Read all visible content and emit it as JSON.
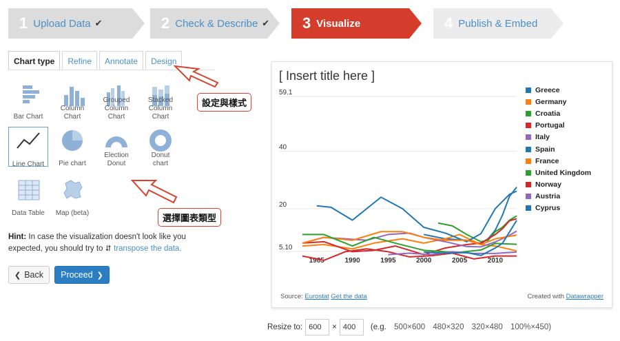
{
  "steps": [
    {
      "num": "1",
      "label": "Upload Data",
      "check": "✔"
    },
    {
      "num": "2",
      "label": "Check & Describe",
      "check": "✔"
    },
    {
      "num": "3",
      "label": "Visualize",
      "check": ""
    },
    {
      "num": "4",
      "label": "Publish & Embed",
      "check": ""
    }
  ],
  "tabs": [
    "Chart type",
    "Refine",
    "Annotate",
    "Design"
  ],
  "chart_types": [
    {
      "label1": "Bar Chart",
      "label2": ""
    },
    {
      "label1": "Column",
      "label2": "Chart"
    },
    {
      "label1": "Grouped",
      "label2": "Column Chart"
    },
    {
      "label1": "Stacked",
      "label2": "Column Chart"
    },
    {
      "label1": "Line Chart",
      "label2": ""
    },
    {
      "label1": "Pie chart",
      "label2": ""
    },
    {
      "label1": "Election",
      "label2": "Donut"
    },
    {
      "label1": "Donut",
      "label2": "chart"
    },
    {
      "label1": "Data Table",
      "label2": ""
    },
    {
      "label1": "Map (beta)",
      "label2": ""
    }
  ],
  "annotations": {
    "settings_style": "設定與樣式",
    "choose_chart_type": "選擇圖表類型"
  },
  "hint": {
    "bold": "Hint:",
    "text": "In case the visualization doesn't look like you expected, you should try to",
    "link": "transpose the data."
  },
  "buttons": {
    "back": "Back",
    "proceed": "Proceed"
  },
  "chart": {
    "title": "[ Insert title here ]",
    "source_label": "Source:",
    "source_link": "Eurostat",
    "get_data": "Get the data",
    "created_with": "Created with",
    "datawrapper": "Datawrapper"
  },
  "resize": {
    "label": "Resize to:",
    "width": "600",
    "times": "×",
    "height": "400",
    "eg": "(e.g.",
    "presets": [
      "500×600",
      "480×320",
      "320×480",
      "100%×450)"
    ]
  },
  "colors": {
    "accent_red": "#d43d2b",
    "link_blue": "#4a90c8"
  },
  "chart_data": {
    "type": "line",
    "title": "[ Insert title here ]",
    "y_ticks": [
      "59.1",
      "40",
      "20",
      "5.10"
    ],
    "x_ticks": [
      "1985",
      "1990",
      "1995",
      "2000",
      "2005",
      "2010"
    ],
    "xlim": [
      1983,
      2013
    ],
    "ylim": [
      5.1,
      59.1
    ],
    "series": [
      {
        "name": "Greece",
        "color": "#1f77b4",
        "x": [
          2000,
          2003,
          2006,
          2008,
          2009,
          2010,
          2011,
          2012,
          2013
        ],
        "y": [
          11,
          9.5,
          9,
          7.8,
          9.5,
          12.5,
          17.7,
          24.3,
          27.5
        ]
      },
      {
        "name": "Germany",
        "color": "#ff7f0e",
        "x": [
          1983,
          1986,
          1990,
          1993,
          1997,
          2000,
          2003,
          2005,
          2008,
          2010,
          2013
        ],
        "y": [
          7,
          7.5,
          6,
          8,
          9.5,
          8,
          9.5,
          11,
          7.5,
          7,
          5.3
        ]
      },
      {
        "name": "Croatia",
        "color": "#2ca02c",
        "x": [
          2002,
          2004,
          2006,
          2008,
          2009,
          2010,
          2011,
          2012,
          2013
        ],
        "y": [
          15,
          14,
          11,
          8.5,
          9,
          12,
          13.5,
          16,
          17.5
        ]
      },
      {
        "name": "Portugal",
        "color": "#d62728",
        "x": [
          1983,
          1986,
          1990,
          1993,
          1996,
          2000,
          2003,
          2006,
          2008,
          2010,
          2011,
          2012,
          2013
        ],
        "y": [
          8,
          8.5,
          5,
          5.5,
          7,
          4,
          6.3,
          7.5,
          8,
          11,
          13,
          15.8,
          16.5
        ]
      },
      {
        "name": "Italy",
        "color": "#9467bd",
        "x": [
          1983,
          1986,
          1989,
          1992,
          1995,
          1998,
          2000,
          2003,
          2006,
          2008,
          2010,
          2012,
          2013
        ],
        "y": [
          8,
          10,
          9.5,
          9,
          11,
          11.5,
          10,
          8.5,
          6.8,
          6.7,
          8.4,
          10.7,
          12.2
        ]
      },
      {
        "name": "Spain",
        "color": "#1f77b4",
        "x": [
          1985,
          1987,
          1990,
          1994,
          1997,
          2000,
          2003,
          2006,
          2008,
          2010,
          2012,
          2013
        ],
        "y": [
          21,
          20.5,
          16,
          24,
          20,
          13.5,
          11.5,
          8.5,
          11.3,
          20,
          25,
          26.1
        ]
      },
      {
        "name": "France",
        "color": "#ff7f0e",
        "x": [
          1983,
          1986,
          1990,
          1994,
          1997,
          2000,
          2003,
          2006,
          2008,
          2010,
          2013
        ],
        "y": [
          8,
          10,
          9,
          12,
          12,
          10,
          9,
          9,
          7.5,
          9.5,
          10.8
        ]
      },
      {
        "name": "United Kingdom",
        "color": "#2ca02c",
        "x": [
          1983,
          1986,
          1990,
          1993,
          1996,
          2000,
          2003,
          2005,
          2008,
          2010,
          2013
        ],
        "y": [
          11,
          11,
          7,
          10,
          8,
          5.5,
          5,
          4.8,
          5.6,
          7.9,
          7.6
        ]
      },
      {
        "name": "Norway",
        "color": "#d62728",
        "x": [
          1983,
          1986,
          1989,
          1992,
          1995,
          1998,
          2001,
          2004,
          2007,
          2010,
          2013
        ],
        "y": [
          3.5,
          2,
          5,
          6,
          5,
          3.2,
          3.6,
          4.5,
          2.5,
          3.5,
          3.5
        ]
      },
      {
        "name": "Austria",
        "color": "#9467bd",
        "x": [
          1995,
          1998,
          2001,
          2004,
          2007,
          2010,
          2013
        ],
        "y": [
          4,
          4.5,
          4,
          5,
          4.4,
          4.4,
          4.9
        ]
      },
      {
        "name": "Cyprus",
        "color": "#1f77b4",
        "x": [
          2000,
          2003,
          2006,
          2008,
          2010,
          2011,
          2012,
          2013
        ],
        "y": [
          4.9,
          4.5,
          4.7,
          3.7,
          6.3,
          7.9,
          11.9,
          15.9
        ]
      }
    ]
  }
}
